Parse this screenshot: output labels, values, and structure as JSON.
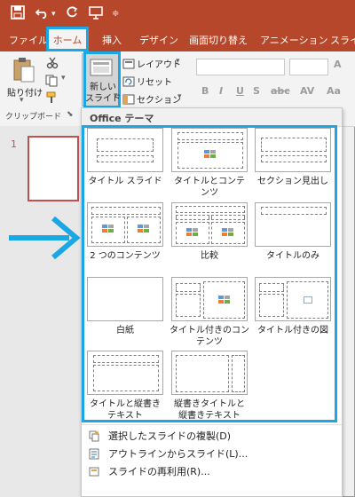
{
  "tabs": [
    "ファイル",
    "ホーム",
    "挿入",
    "デザイン",
    "画面切り替え",
    "アニメーション",
    "スライ"
  ],
  "ribbon": {
    "paste_label": "貼り付け",
    "new_slide_label_1": "新しい",
    "new_slide_label_2": "スライド",
    "layout_label": "レイアウト",
    "reset_label": "リセット",
    "section_label": "セクション",
    "clipboard_group": "クリップボード"
  },
  "slides": {
    "number": "1"
  },
  "dropdown": {
    "header": "Office テーマ",
    "layouts": [
      "タイトル スライド",
      "タイトルとコンテンツ",
      "セクション見出し",
      "2 つのコンテンツ",
      "比較",
      "タイトルのみ",
      "白紙",
      "タイトル付きのコンテンツ",
      "タイトル付きの図",
      "タイトルと縦書きテキスト",
      "縦書きタイトルと縦書きテキスト"
    ],
    "menu": [
      "選択したスライドの複製(D)",
      "アウトラインからスライド(L)...",
      "スライドの再利用(R)..."
    ]
  }
}
